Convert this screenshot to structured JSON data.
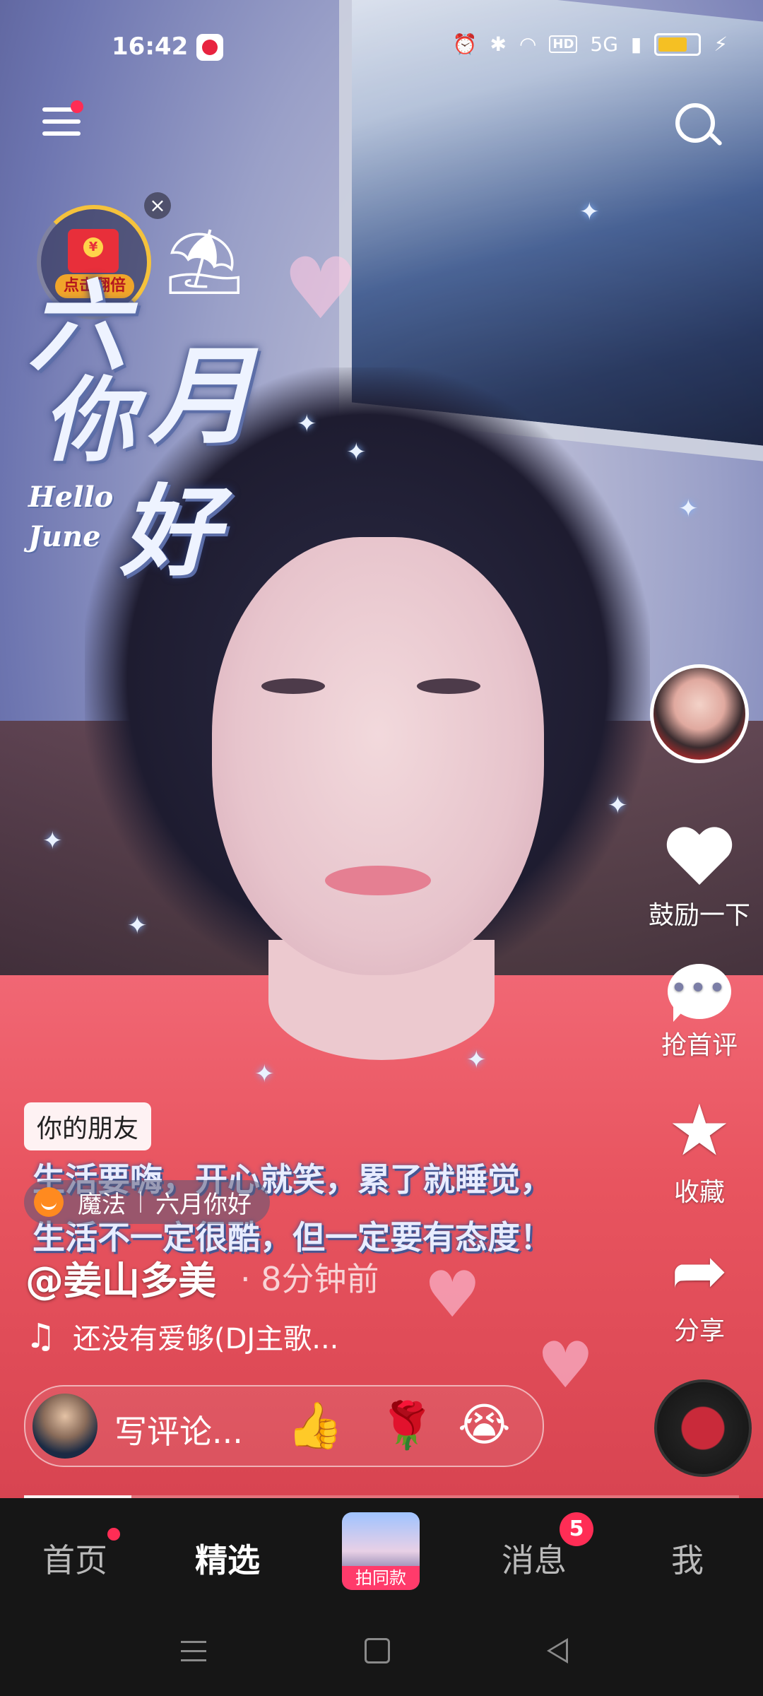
{
  "status": {
    "time": "16:42",
    "network_label": "5G",
    "hd_label": "HD"
  },
  "sticker": {
    "line1": "六",
    "line2a": "你",
    "line2b": "月",
    "line3": "好",
    "en1": "Hello",
    "en2": "June"
  },
  "red_packet": {
    "label": "点击翻倍",
    "coin": "¥",
    "close": "×"
  },
  "actions": {
    "like": "鼓励一下",
    "comment": "抢首评",
    "favorite": "收藏",
    "share": "分享"
  },
  "video": {
    "friend_tag": "你的朋友",
    "caption_line1": "生活要嗨，开心就笑，累了就睡觉，",
    "caption_line2": "生活不一定很酷，但一定要有态度！",
    "magic_label": "魔法",
    "effect_name": "六月你好",
    "author": "@姜山多美",
    "posted": "· 8分钟前",
    "music": "还没有爱够(DJ主歌..."
  },
  "comment_bar": {
    "placeholder": "写评论...",
    "emojis": [
      "👍",
      "🌹",
      "😭"
    ]
  },
  "progress": {
    "value": 0.15
  },
  "tabs": {
    "home": "首页",
    "featured": "精选",
    "create": "拍同款",
    "messages": "消息",
    "messages_badge": "5",
    "me": "我"
  },
  "colors": {
    "accent": "#ff2d55",
    "tabbar": "#161616"
  },
  "icons": [
    "menu-icon",
    "search-icon",
    "heart-icon",
    "comment-icon",
    "star-icon",
    "share-icon",
    "music-note-icon",
    "close-icon"
  ]
}
